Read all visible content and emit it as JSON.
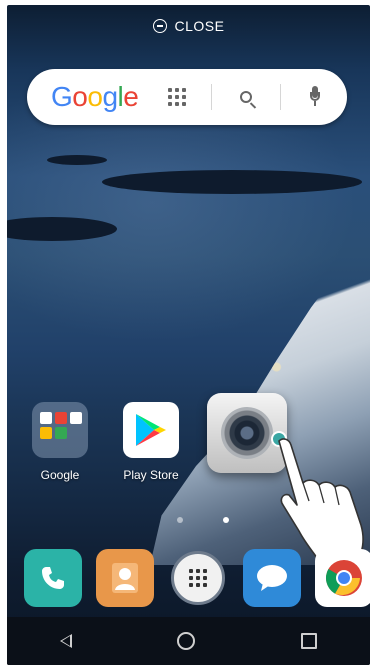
{
  "top_bar": {
    "close_label": "CLOSE",
    "icon": "minus-circle-icon"
  },
  "search_bar": {
    "logo_letters": [
      {
        "ch": "G",
        "color": "#4285F4"
      },
      {
        "ch": "o",
        "color": "#EA4335"
      },
      {
        "ch": "o",
        "color": "#FBBC05"
      },
      {
        "ch": "g",
        "color": "#4285F4"
      },
      {
        "ch": "l",
        "color": "#34A853"
      },
      {
        "ch": "e",
        "color": "#EA4335"
      }
    ],
    "icons": [
      "apps-grid-icon",
      "search-icon",
      "microphone-icon"
    ]
  },
  "home_apps": [
    {
      "label": "Google",
      "icon": "folder-icon"
    },
    {
      "label": "Play Store",
      "icon": "play-store-icon"
    }
  ],
  "dragging_app": {
    "icon": "camera-icon"
  },
  "page_indicator": {
    "count": 2,
    "active": 1
  },
  "dock": [
    {
      "icon": "phone-icon",
      "color": "#2bb3a7"
    },
    {
      "icon": "contacts-icon",
      "color": "#e8974a"
    },
    {
      "icon": "app-drawer-icon",
      "color": "#ffffff"
    },
    {
      "icon": "messages-icon",
      "color": "#2f8ad8"
    },
    {
      "icon": "chrome-icon",
      "color": "#ffffff"
    }
  ],
  "nav": [
    "back-icon",
    "home-icon",
    "recent-apps-icon"
  ]
}
